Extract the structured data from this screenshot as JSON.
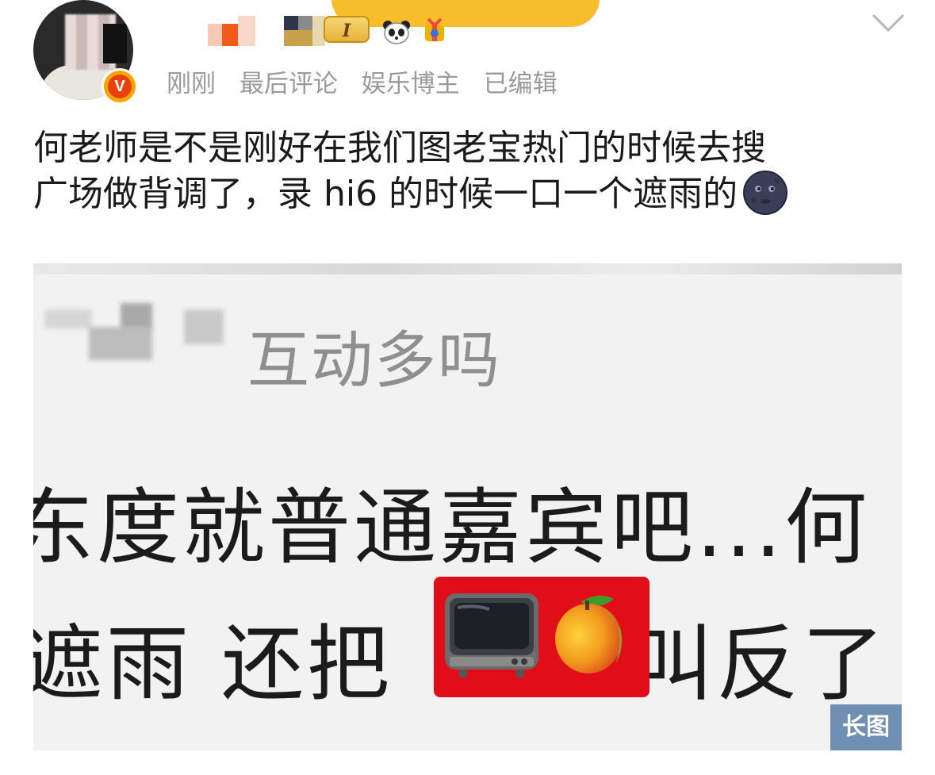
{
  "post": {
    "meta": {
      "time": "刚刚",
      "sort": "最后评论",
      "author_tag": "娱乐博主",
      "edited": "已编辑"
    },
    "badges": {
      "verified": "V",
      "medal": "I"
    },
    "text_line1": "何老师是不是刚好在我们图老宝热门的时候去搜",
    "text_line2": "广场做背调了，录 hi6 的时候一口一个遮雨的",
    "emoji": "new-moon-face-icon"
  },
  "attachment": {
    "row1": "互动多吗",
    "row2": "东度就普通嘉宾吧...何",
    "row3_left": "遮雨 还把",
    "row3_right": "叫反了",
    "badge": "长图",
    "sticker_icons": [
      "tv-icon",
      "mango-icon"
    ],
    "sticker_bg": "#e10e1a"
  },
  "colors": {
    "accent_yellow": "#f7bd2a",
    "meta_gray": "#9a9a9a",
    "badge_blue": "#6f8fb3"
  }
}
